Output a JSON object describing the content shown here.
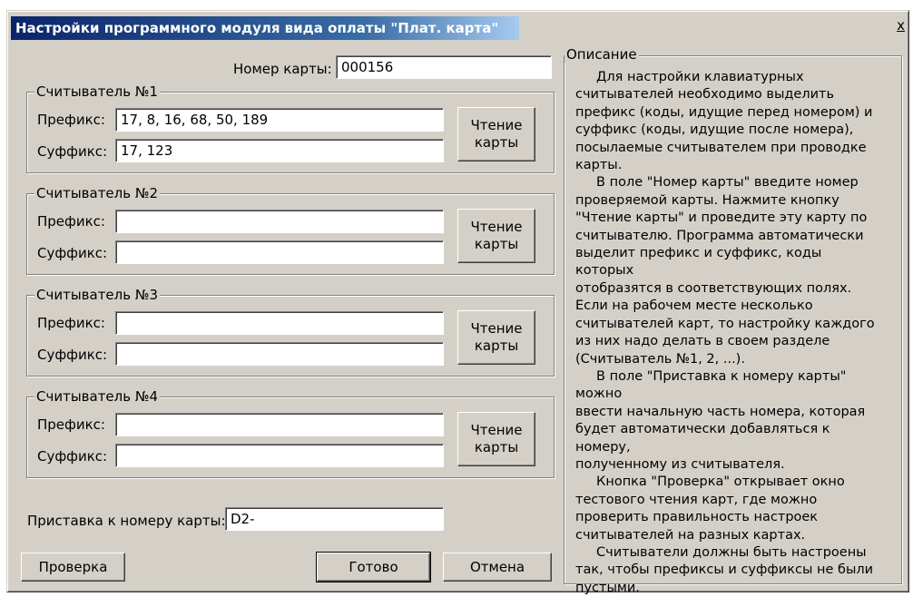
{
  "window": {
    "title": "Настройки программного модуля вида оплаты \"Плат. карта\"",
    "close_label": "x"
  },
  "card_number": {
    "label": "Номер карты:",
    "value": "000156"
  },
  "readers": [
    {
      "title": "Считыватель №1",
      "prefix_label": "Префикс:",
      "prefix_value": "17, 8, 16, 68, 50, 189",
      "suffix_label": "Суффикс:",
      "suffix_value": "17, 123",
      "read_button": "Чтение\nкарты"
    },
    {
      "title": "Считыватель №2",
      "prefix_label": "Префикс:",
      "prefix_value": "",
      "suffix_label": "Суффикс:",
      "suffix_value": "",
      "read_button": "Чтение\nкарты"
    },
    {
      "title": "Считыватель №3",
      "prefix_label": "Префикс:",
      "prefix_value": "",
      "suffix_label": "Суффикс:",
      "suffix_value": "",
      "read_button": "Чтение\nкарты"
    },
    {
      "title": "Считыватель №4",
      "prefix_label": "Префикс:",
      "prefix_value": "",
      "suffix_label": "Суффикс:",
      "suffix_value": "",
      "read_button": "Чтение\nкарты"
    }
  ],
  "prefix_attach": {
    "label": "Приставка к номеру карты:",
    "value": "D2-"
  },
  "buttons": {
    "check": "Проверка",
    "done": "Готово",
    "cancel": "Отмена"
  },
  "description": {
    "title": "Описание",
    "text": "     Для настройки клавиатурных\nсчитывателей необходимо выделить\nпрефикс (коды, идущие перед номером) и\nсуффикс (коды, идущие после номера),\nпосылаемые считывателем при проводке\nкарты.\n     В поле \"Номер карты\" введите номер\nпроверяемой карты. Нажмите кнопку\n\"Чтение карты\" и проведите эту карту по\nсчитывателю. Программа автоматически\nвыделит префикс и суффикс, коды которых\nотобразятся в соответствующих полях.\nЕсли на рабочем месте несколько\nсчитывателей карт, то настройку каждого\nиз них надо делать в своем разделе\n(Считыватель №1, 2, ...).\n     В поле \"Приставка к номеру карты\" можно\nввести начальную часть номера, которая\nбудет автоматически добавляться к номеру,\nполученному из считывателя.\n     Кнопка \"Проверка\" открывает окно\nтестового чтения карт, где можно\nпроверить правильность настроек\nсчитывателей на разных картах.\n     Считыватели должны быть настроены\nтак, чтобы префиксы и суффиксы не были\nпустыми."
  }
}
